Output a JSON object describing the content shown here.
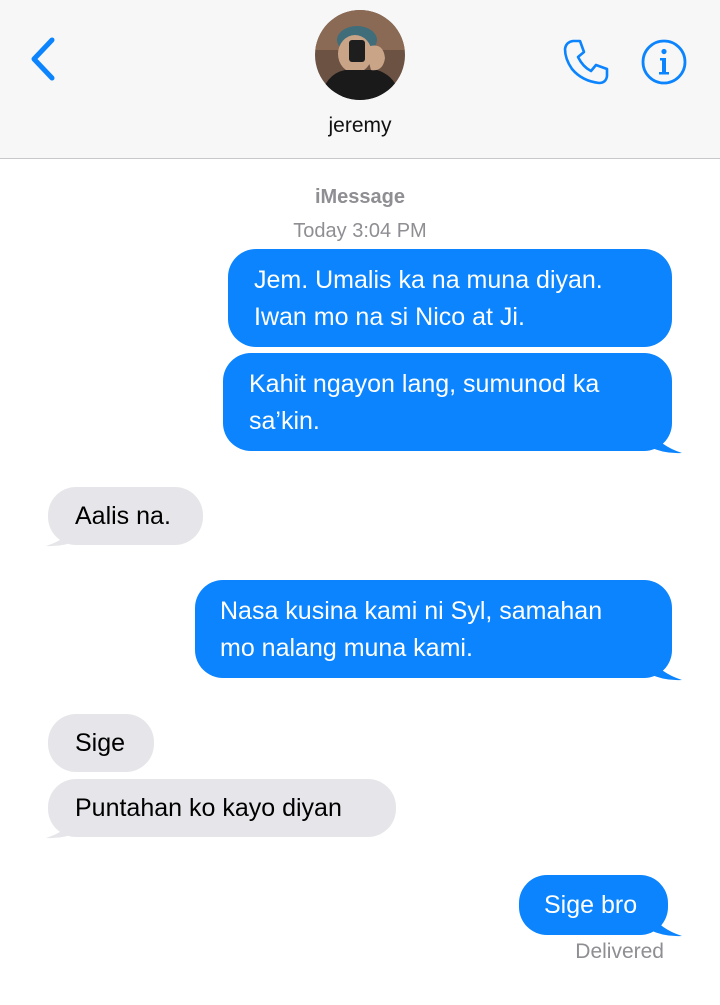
{
  "header": {
    "contact_name": "jeremy",
    "back_icon": "chevron-left-icon",
    "call_icon": "phone-icon",
    "info_icon": "info-icon",
    "accent_color": "#0b84fe"
  },
  "conversation": {
    "service": "iMessage",
    "timestamp": "Today 3:04 PM",
    "messages": [
      {
        "direction": "sent",
        "text": "Jem. Umalis ka na muna diyan.\nIwan mo na si Nico at Ji."
      },
      {
        "direction": "sent",
        "text": "Kahit ngayon lang, sumunod ka\nsa’kin."
      },
      {
        "direction": "received",
        "text": "Aalis na."
      },
      {
        "direction": "sent",
        "text": "Nasa kusina kami ni Syl, samahan\nmo nalang muna kami."
      },
      {
        "direction": "received",
        "text": "Sige"
      },
      {
        "direction": "received",
        "text": "Puntahan ko kayo diyan"
      },
      {
        "direction": "sent",
        "text": "Sige bro"
      }
    ],
    "status": "Delivered",
    "sent_color": "#0b84fe",
    "received_color": "#e6e6ea"
  }
}
